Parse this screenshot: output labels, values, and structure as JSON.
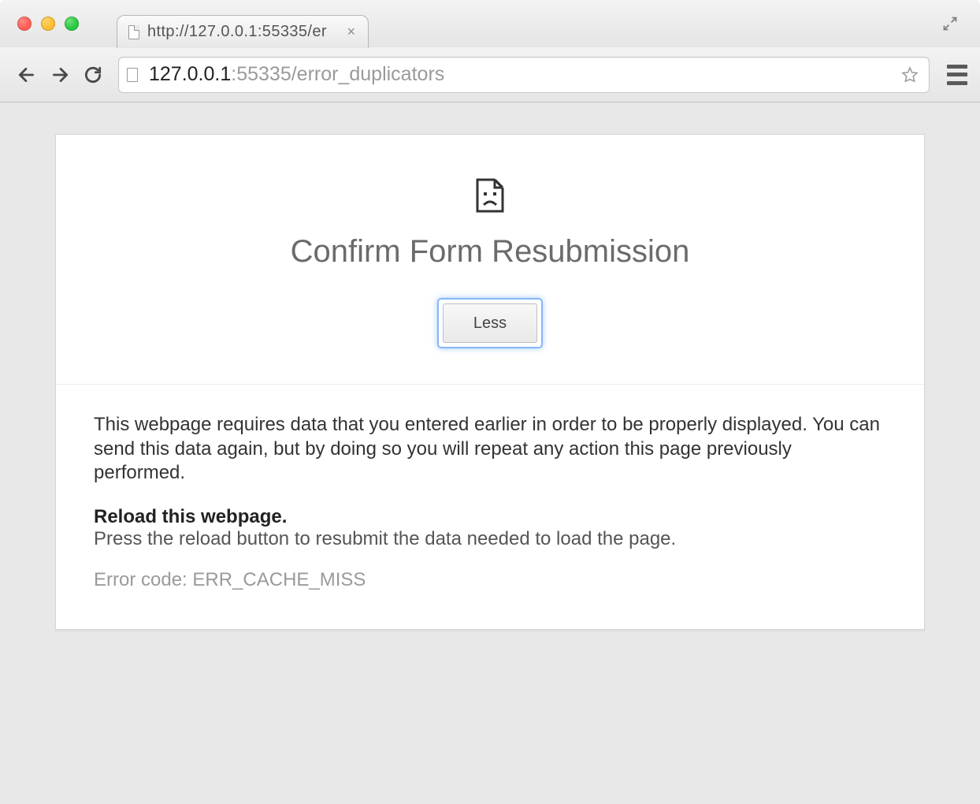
{
  "tab": {
    "title": "http://127.0.0.1:55335/er"
  },
  "omnibox": {
    "host": "127.0.0.1",
    "port": ":55335",
    "path": "/error_duplicators"
  },
  "page": {
    "title": "Confirm Form Resubmission",
    "less_label": "Less",
    "para1": "This webpage requires data that you entered earlier in order to be properly displayed. You can send this data again, but by doing so you will repeat any action this page previously performed.",
    "reload_heading": "Reload this webpage.",
    "reload_sub": "Press the reload button to resubmit the data needed to load the page.",
    "error_code": "Error code: ERR_CACHE_MISS"
  }
}
